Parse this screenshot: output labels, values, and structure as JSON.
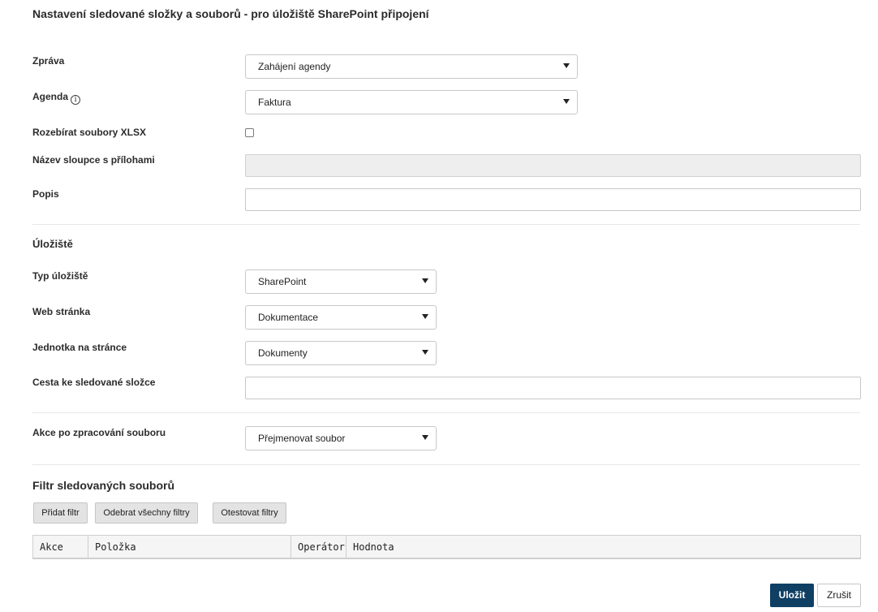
{
  "page": {
    "title": "Nastavení sledované složky a souborů - pro úložiště SharePoint připojení"
  },
  "form": {
    "zprava": {
      "label": "Zpráva",
      "value": "Zahájení agendy"
    },
    "agenda": {
      "label": "Agenda",
      "value": "Faktura",
      "info_icon": "i"
    },
    "rozebirat": {
      "label": "Rozebírat soubory XLSX",
      "checked": false
    },
    "nazev_sloupce": {
      "label": "Název sloupce s přílohami",
      "value": ""
    },
    "popis": {
      "label": "Popis",
      "value": ""
    }
  },
  "storage": {
    "heading": "Úložiště",
    "typ": {
      "label": "Typ úložiště",
      "value": "SharePoint"
    },
    "web": {
      "label": "Web stránka",
      "value": "Dokumentace"
    },
    "jednotka": {
      "label": "Jednotka na stránce",
      "value": "Dokumenty"
    },
    "cesta": {
      "label": "Cesta ke sledované složce",
      "value": ""
    }
  },
  "action": {
    "label": "Akce po zpracování souboru",
    "value": "Přejmenovat soubor"
  },
  "filter": {
    "heading": "Filtr sledovaných souborů",
    "add_label": "Přidat filtr",
    "remove_all_label": "Odebrat všechny filtry",
    "test_label": "Otestovat filtry",
    "columns": [
      "Akce",
      "Položka",
      "Operátor",
      "Hodnota"
    ]
  },
  "footer": {
    "save_label": "Uložit",
    "cancel_label": "Zrušit"
  },
  "colors": {
    "primary": "#0f3f63",
    "gray_button": "#e3e3e3",
    "border": "#c8c8c8"
  }
}
